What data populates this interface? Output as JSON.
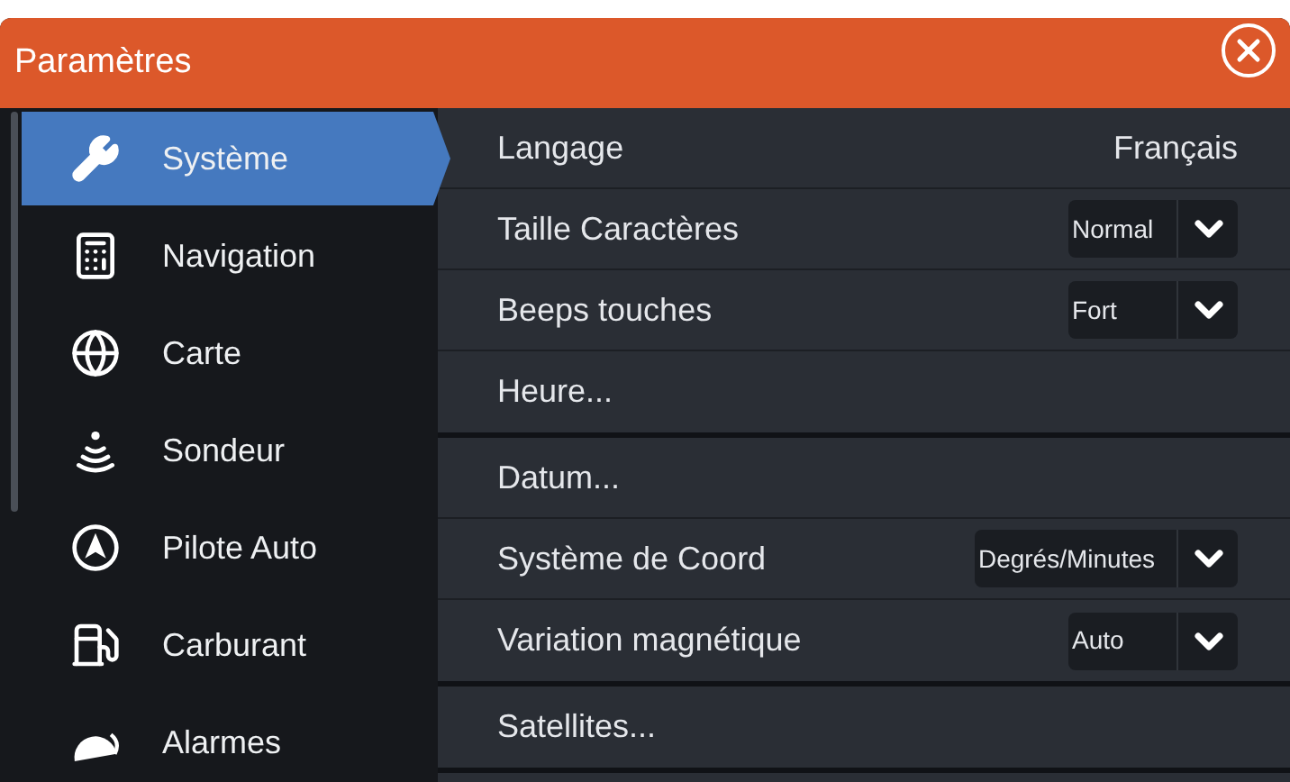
{
  "window": {
    "title": "Paramètres"
  },
  "sidebar": {
    "items": [
      {
        "label": "Système",
        "selected": true
      },
      {
        "label": "Navigation",
        "selected": false
      },
      {
        "label": "Carte",
        "selected": false
      },
      {
        "label": "Sondeur",
        "selected": false
      },
      {
        "label": "Pilote Auto",
        "selected": false
      },
      {
        "label": "Carburant",
        "selected": false
      },
      {
        "label": "Alarmes",
        "selected": false
      }
    ]
  },
  "settings": {
    "sections": [
      {
        "rows": [
          {
            "kind": "value",
            "label": "Langage",
            "value": "Français"
          },
          {
            "kind": "dropdown",
            "label": "Taille Caractères",
            "value": "Normal"
          },
          {
            "kind": "dropdown",
            "label": "Beeps touches",
            "value": "Fort"
          },
          {
            "kind": "link",
            "label": "Heure..."
          }
        ]
      },
      {
        "rows": [
          {
            "kind": "link",
            "label": "Datum..."
          },
          {
            "kind": "dropdown",
            "label": "Système de Coord",
            "value": "Degrés/Minutes"
          },
          {
            "kind": "dropdown",
            "label": "Variation magnétique",
            "value": "Auto"
          }
        ]
      },
      {
        "rows": [
          {
            "kind": "link",
            "label": "Satellites..."
          }
        ]
      }
    ]
  }
}
